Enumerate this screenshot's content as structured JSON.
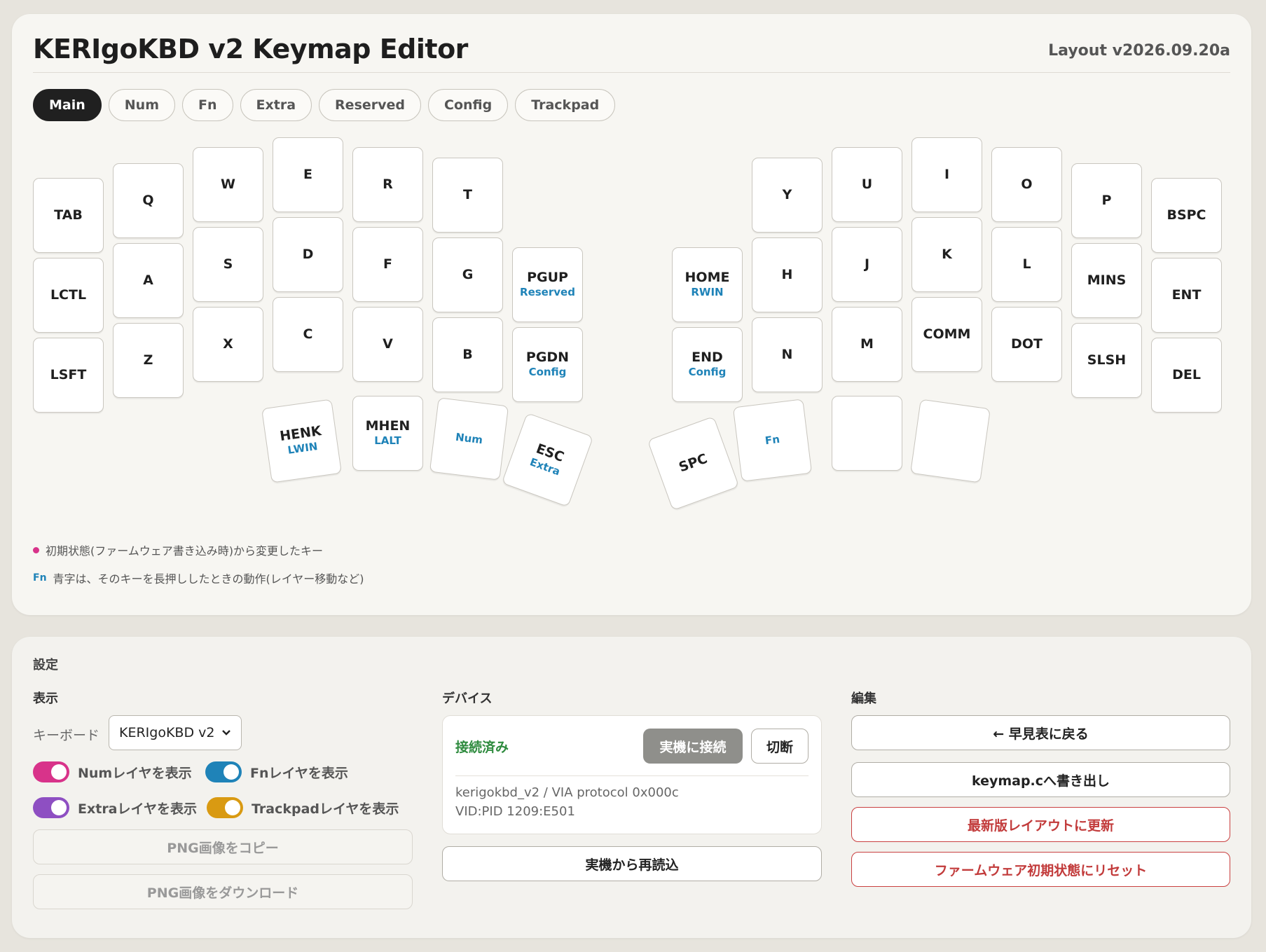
{
  "header": {
    "title": "KERIgoKBD v2 Keymap Editor",
    "version": "Layout v2026.09.20a"
  },
  "tabs": [
    {
      "label": "Main",
      "active": true
    },
    {
      "label": "Num"
    },
    {
      "label": "Fn"
    },
    {
      "label": "Extra"
    },
    {
      "label": "Reserved"
    },
    {
      "label": "Config"
    },
    {
      "label": "Trackpad"
    }
  ],
  "keys": [
    {
      "label": "TAB",
      "hold": ""
    },
    {
      "label": "LCTL",
      "hold": ""
    },
    {
      "label": "LSFT",
      "hold": ""
    },
    {
      "label": "Q",
      "hold": ""
    },
    {
      "label": "A",
      "hold": ""
    },
    {
      "label": "Z",
      "hold": ""
    },
    {
      "label": "W",
      "hold": ""
    },
    {
      "label": "S",
      "hold": ""
    },
    {
      "label": "X",
      "hold": ""
    },
    {
      "label": "E",
      "hold": ""
    },
    {
      "label": "D",
      "hold": ""
    },
    {
      "label": "C",
      "hold": ""
    },
    {
      "label": "R",
      "hold": ""
    },
    {
      "label": "F",
      "hold": ""
    },
    {
      "label": "V",
      "hold": ""
    },
    {
      "label": "T",
      "hold": ""
    },
    {
      "label": "G",
      "hold": ""
    },
    {
      "label": "B",
      "hold": ""
    },
    {
      "label": "PGUP",
      "hold": "Reserved"
    },
    {
      "label": "PGDN",
      "hold": "Config"
    },
    {
      "label": "HOME",
      "hold": "RWIN"
    },
    {
      "label": "END",
      "hold": "Config"
    },
    {
      "label": "Y",
      "hold": ""
    },
    {
      "label": "H",
      "hold": ""
    },
    {
      "label": "N",
      "hold": ""
    },
    {
      "label": "U",
      "hold": ""
    },
    {
      "label": "J",
      "hold": ""
    },
    {
      "label": "M",
      "hold": ""
    },
    {
      "label": "I",
      "hold": ""
    },
    {
      "label": "K",
      "hold": ""
    },
    {
      "label": "COMM",
      "hold": ""
    },
    {
      "label": "O",
      "hold": ""
    },
    {
      "label": "L",
      "hold": ""
    },
    {
      "label": "DOT",
      "hold": ""
    },
    {
      "label": "P",
      "hold": ""
    },
    {
      "label": "MINS",
      "hold": ""
    },
    {
      "label": "SLSH",
      "hold": ""
    },
    {
      "label": "BSPC",
      "hold": ""
    },
    {
      "label": "ENT",
      "hold": ""
    },
    {
      "label": "DEL",
      "hold": ""
    },
    {
      "label": "HENK",
      "hold": "LWIN"
    },
    {
      "label": "MHEN",
      "hold": "LALT"
    },
    {
      "label": "",
      "hold": "Num"
    },
    {
      "label": "ESC",
      "hold": "Extra"
    },
    {
      "label": "SPC",
      "hold": ""
    },
    {
      "label": "",
      "hold": "Fn"
    },
    {
      "label": "",
      "hold": ""
    },
    {
      "label": "",
      "hold": ""
    }
  ],
  "legend": {
    "changed": "初期状態(ファームウェア書き込み時)から変更したキー",
    "fn_sample": "Fn",
    "hold": "青字は、そのキーを長押ししたときの動作(レイヤー移動など)"
  },
  "settings": {
    "title": "設定",
    "display": {
      "title": "表示",
      "keyboard_label": "キーボード",
      "keyboard_value": "KERIgoKBD v2",
      "toggles": [
        {
          "label": "Numレイヤを表示",
          "color": "#d8338a"
        },
        {
          "label": "Fnレイヤを表示",
          "color": "#1f83b8"
        },
        {
          "label": "Extraレイヤを表示",
          "color": "#8e4fc2"
        },
        {
          "label": "Trackpadレイヤを表示",
          "color": "#d99a12"
        }
      ],
      "copy_png": "PNG画像をコピー",
      "download_png": "PNG画像をダウンロード"
    },
    "device": {
      "title": "デバイス",
      "status": "接続済み",
      "connect": "実機に接続",
      "disconnect": "切断",
      "info_line1": "kerigokbd_v2 / VIA protocol 0x000c",
      "info_line2": "VID:PID 1209:E501",
      "reload": "実機から再読込"
    },
    "edit": {
      "title": "編集",
      "back": "← 早見表に戻る",
      "export": "keymap.cへ書き出し",
      "update_layout": "最新版レイアウトに更新",
      "factory_reset": "ファームウェア初期状態にリセット"
    }
  }
}
